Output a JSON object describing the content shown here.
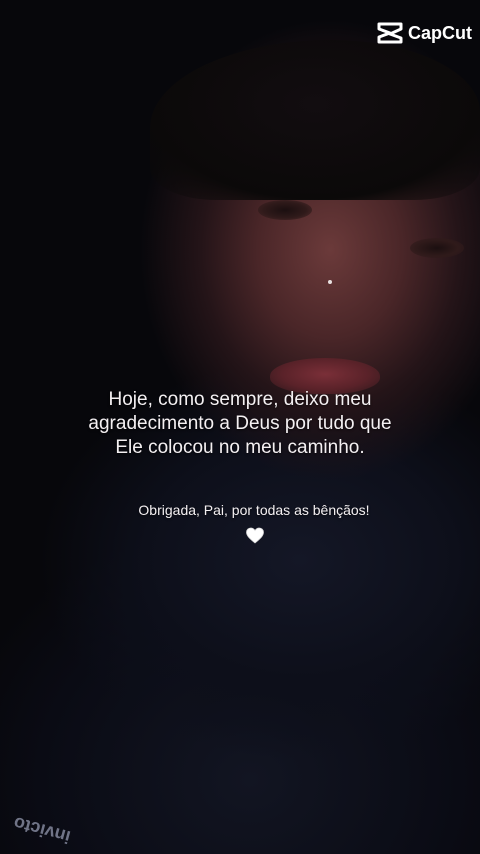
{
  "watermark": {
    "brand": "CapCut",
    "icon": "capcut-logo-icon"
  },
  "caption": {
    "lines": [
      "Hoje, como sempre, deixo meu",
      "agradecimento a Deus por tudo que",
      "Ele colocou no meu caminho."
    ],
    "subtitle": "Obrigada, Pai, por todas as bênçãos!",
    "emoji": "white-heart-icon"
  },
  "shirt_print": "invicto",
  "colors": {
    "text": "#f4f0f2",
    "background": "#07070b",
    "heart": "#ffffff"
  }
}
